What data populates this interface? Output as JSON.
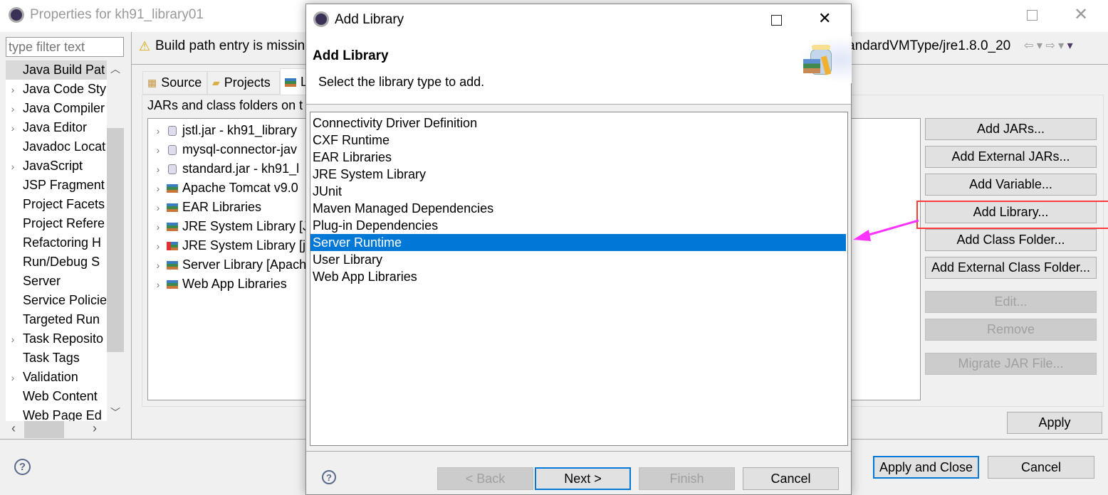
{
  "window": {
    "title": "Properties for kh91_library01"
  },
  "filter": {
    "placeholder": "type filter text"
  },
  "sidebar": {
    "items": [
      {
        "label": "Java Build Pat",
        "expandable": false,
        "selected": true
      },
      {
        "label": "Java Code Sty",
        "expandable": true
      },
      {
        "label": "Java Compiler",
        "expandable": true
      },
      {
        "label": "Java Editor",
        "expandable": true
      },
      {
        "label": "Javadoc Locat",
        "expandable": false
      },
      {
        "label": "JavaScript",
        "expandable": true
      },
      {
        "label": "JSP Fragment",
        "expandable": false
      },
      {
        "label": "Project Facets",
        "expandable": false
      },
      {
        "label": "Project Refere",
        "expandable": false
      },
      {
        "label": "Refactoring H",
        "expandable": false
      },
      {
        "label": "Run/Debug S",
        "expandable": false
      },
      {
        "label": "Server",
        "expandable": false
      },
      {
        "label": "Service Policie",
        "expandable": false
      },
      {
        "label": "Targeted Run",
        "expandable": false
      },
      {
        "label": "Task Reposito",
        "expandable": true
      },
      {
        "label": "Task Tags",
        "expandable": false
      },
      {
        "label": "Validation",
        "expandable": true
      },
      {
        "label": "Web Content",
        "expandable": false
      },
      {
        "label": "Web Page Ed",
        "expandable": false
      }
    ]
  },
  "message": {
    "left": "Build path entry is missin",
    "right": "andardVMType/jre1.8.0_20"
  },
  "tabs": [
    {
      "label": "Source"
    },
    {
      "label": "Projects"
    },
    {
      "label": "L"
    }
  ],
  "panel": {
    "label": "JARs and class folders on t"
  },
  "build_path": [
    {
      "label": "jstl.jar - kh91_library",
      "type": "jar"
    },
    {
      "label": "mysql-connector-jav",
      "type": "jar"
    },
    {
      "label": "standard.jar - kh91_l",
      "type": "jar"
    },
    {
      "label": "Apache Tomcat v9.0",
      "type": "lib"
    },
    {
      "label": "EAR Libraries",
      "type": "lib"
    },
    {
      "label": "JRE System Library [J",
      "type": "lib"
    },
    {
      "label": "JRE System Library [j",
      "type": "lib-error"
    },
    {
      "label": "Server Library [Apach",
      "type": "lib"
    },
    {
      "label": "Web App Libraries",
      "type": "lib"
    }
  ],
  "side_buttons": {
    "add_jars": "Add JARs...",
    "add_external_jars": "Add External JARs...",
    "add_variable": "Add Variable...",
    "add_library": "Add Library...",
    "add_class_folder": "Add Class Folder...",
    "add_external_class_folder": "Add External Class Folder...",
    "edit": "Edit...",
    "remove": "Remove",
    "migrate": "Migrate JAR File..."
  },
  "footer": {
    "apply": "Apply",
    "apply_close": "Apply and Close",
    "cancel": "Cancel"
  },
  "dialog": {
    "title": "Add Library",
    "header": "Add Library",
    "subtitle": "Select the library type to add.",
    "items": [
      "Connectivity Driver Definition",
      "CXF Runtime",
      "EAR Libraries",
      "JRE System Library",
      "JUnit",
      "Maven Managed Dependencies",
      "Plug-in Dependencies",
      "Server Runtime",
      "User Library",
      "Web App Libraries"
    ],
    "selected": "Server Runtime",
    "buttons": {
      "back": "< Back",
      "next": "Next >",
      "finish": "Finish",
      "cancel": "Cancel"
    }
  },
  "colors": {
    "selection": "#0078d7",
    "annotation": "#ff3b3b",
    "arrow": "#ff33ff"
  }
}
